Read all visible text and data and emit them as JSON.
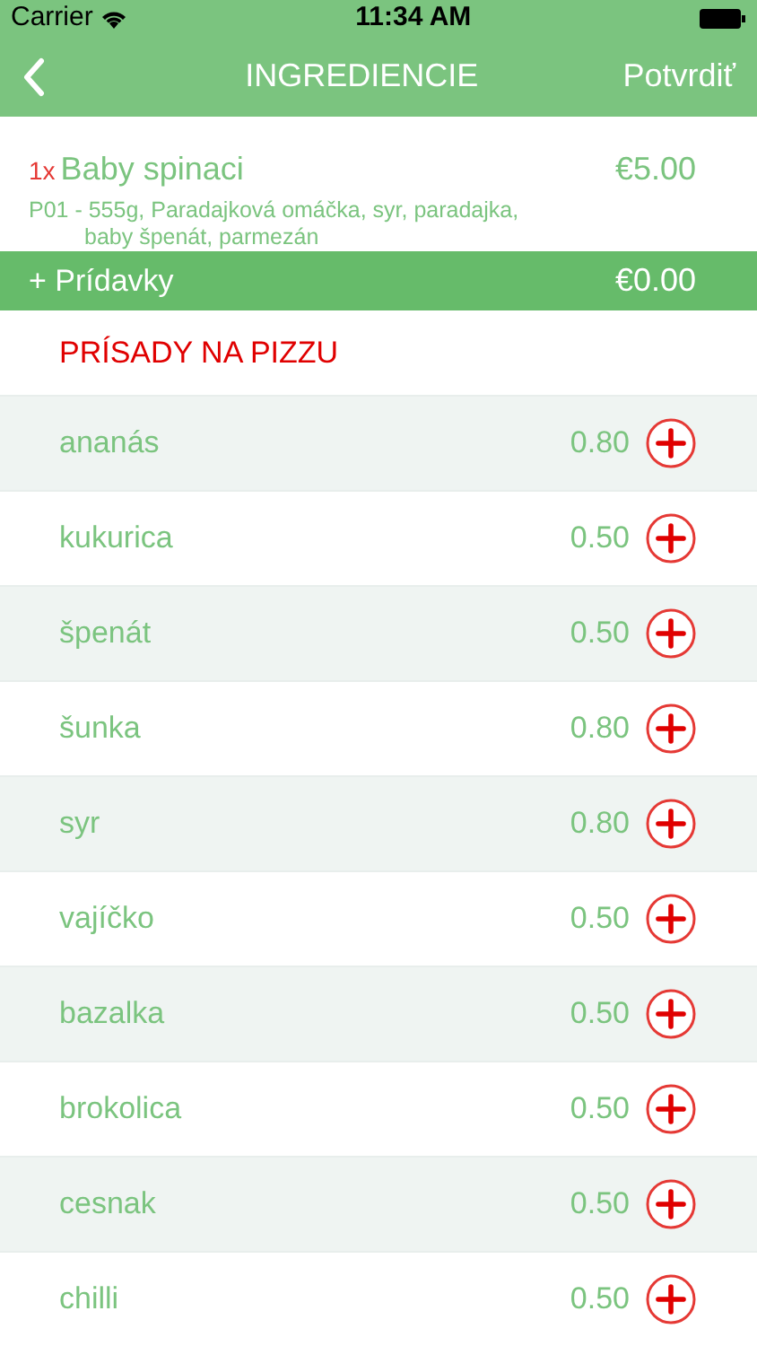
{
  "status_bar": {
    "carrier": "Carrier",
    "time": "11:34 AM"
  },
  "nav": {
    "title": "INGREDIENCIE",
    "confirm": "Potvrdiť"
  },
  "item": {
    "quantity": "1x",
    "name": "Baby spinaci",
    "price": "€5.00",
    "description": "P01 - 555g, Paradajková omáčka, syr, paradajka, baby špenát, parmezán"
  },
  "extras": {
    "label": "+ Prídavky",
    "price": "€0.00"
  },
  "section_title": "PRÍSADY NA PIZZU",
  "toppings": [
    {
      "name": "ananás",
      "price": "0.80"
    },
    {
      "name": "kukurica",
      "price": "0.50"
    },
    {
      "name": "špenát",
      "price": "0.50"
    },
    {
      "name": "šunka",
      "price": "0.80"
    },
    {
      "name": "syr",
      "price": "0.80"
    },
    {
      "name": "vajíčko",
      "price": "0.50"
    },
    {
      "name": "bazalka",
      "price": "0.50"
    },
    {
      "name": "brokolica",
      "price": "0.50"
    },
    {
      "name": "cesnak",
      "price": "0.50"
    },
    {
      "name": "chilli",
      "price": "0.50"
    }
  ]
}
